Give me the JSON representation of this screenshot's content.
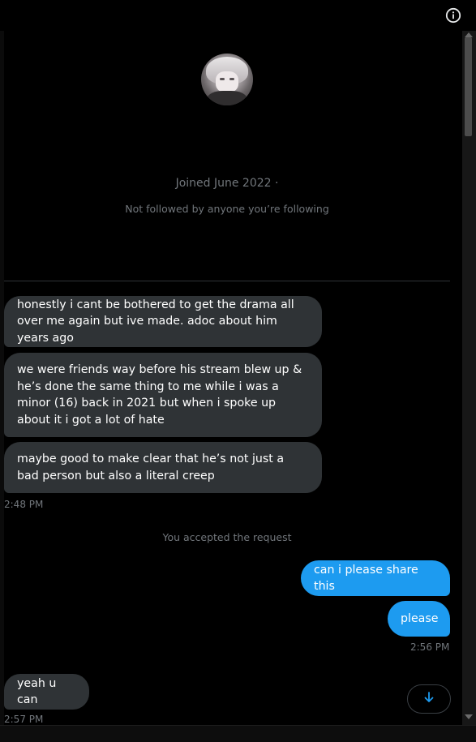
{
  "profile": {
    "joined": "Joined June 2022 ·",
    "followed": "Not followed by anyone you’re following"
  },
  "messages": [
    {
      "text": "honestly i cant be bothered to get the drama all over me again but ive made. adoc about him years ago"
    },
    {
      "text": "we were friends way before his stream blew up & he’s done the same thing to me while i was a minor (16) back in 2021 but when i spoke up about it i got a lot of hate"
    },
    {
      "text": "maybe good to make clear that he’s not just a bad person but also a literal creep"
    },
    {
      "text": "can i please share this"
    },
    {
      "text": "please"
    },
    {
      "text": "yeah u can"
    }
  ],
  "timestamps": {
    "first": "2:48 PM",
    "second": "2:56 PM",
    "third": "2:57 PM"
  },
  "system": {
    "accepted": "You accepted the request"
  },
  "icons": {
    "info": "info-icon",
    "scroll": "arrow-down-icon"
  },
  "colors": {
    "accent": "#1d9bf0",
    "incoming_bubble": "#2f3336",
    "background": "#000000"
  }
}
